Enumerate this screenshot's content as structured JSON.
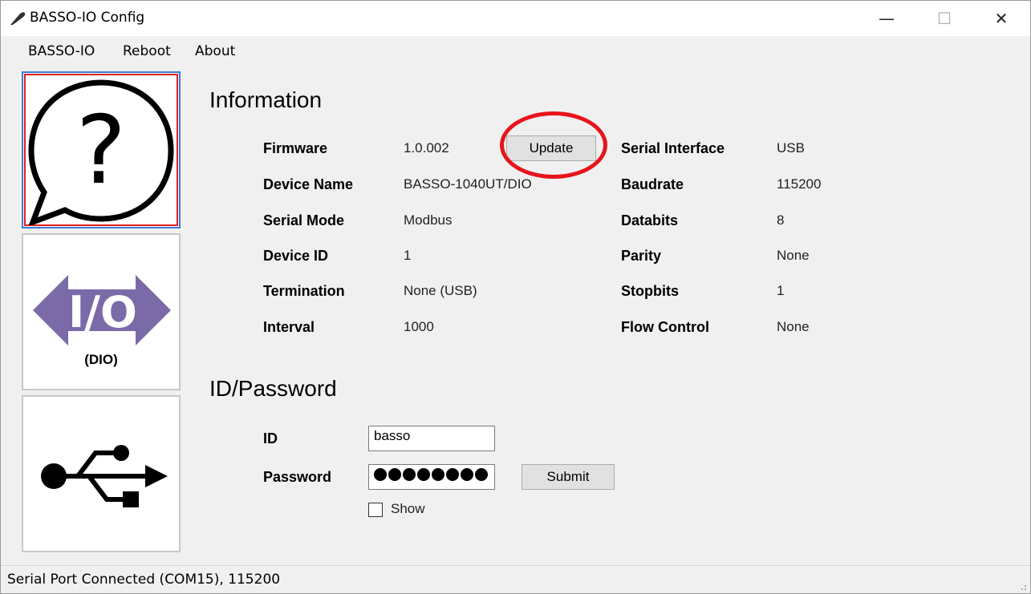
{
  "window": {
    "title": "BASSO-IO Config",
    "icon": "app-feather-icon",
    "controls": {
      "minimize": "—",
      "maximize": "☐",
      "close": "✕"
    }
  },
  "menu": {
    "items": [
      {
        "label": "BASSO-IO"
      },
      {
        "label": "Reboot"
      },
      {
        "label": "About"
      }
    ]
  },
  "sidebar": {
    "items": [
      {
        "name": "information",
        "icon": "help-speech-bubble-icon",
        "glyph": "?",
        "selected": true
      },
      {
        "name": "dio",
        "icon": "io-arrow-icon",
        "glyph": "I/O",
        "caption": "(DIO)",
        "selected": false
      },
      {
        "name": "usb",
        "icon": "usb-icon",
        "selected": false
      }
    ]
  },
  "information": {
    "title": "Information",
    "update_label": "Update",
    "left": [
      {
        "label": "Firmware",
        "value": "1.0.002"
      },
      {
        "label": "Device Name",
        "value": "BASSO-1040UT/DIO"
      },
      {
        "label": "Serial Mode",
        "value": "Modbus"
      },
      {
        "label": "Device ID",
        "value": "1"
      },
      {
        "label": "Termination",
        "value": "None (USB)"
      },
      {
        "label": "Interval",
        "value": "1000"
      }
    ],
    "right": [
      {
        "label": "Serial Interface",
        "value": "USB"
      },
      {
        "label": "Baudrate",
        "value": "115200"
      },
      {
        "label": "Databits",
        "value": "8"
      },
      {
        "label": "Parity",
        "value": "None"
      },
      {
        "label": "Stopbits",
        "value": "1"
      },
      {
        "label": "Flow Control",
        "value": "None"
      }
    ]
  },
  "credentials": {
    "title": "ID/Password",
    "id_label": "ID",
    "id_value": "basso",
    "password_label": "Password",
    "password_mask_count": 8,
    "submit_label": "Submit",
    "show_label": "Show",
    "show_checked": false
  },
  "status": {
    "text": "Serial Port Connected (COM15), 115200"
  },
  "colors": {
    "selection_border": "#3a7bd5",
    "selection_inner": "#e02020",
    "annotation": "#e8141c",
    "io_arrow": "#7b6aa8"
  }
}
